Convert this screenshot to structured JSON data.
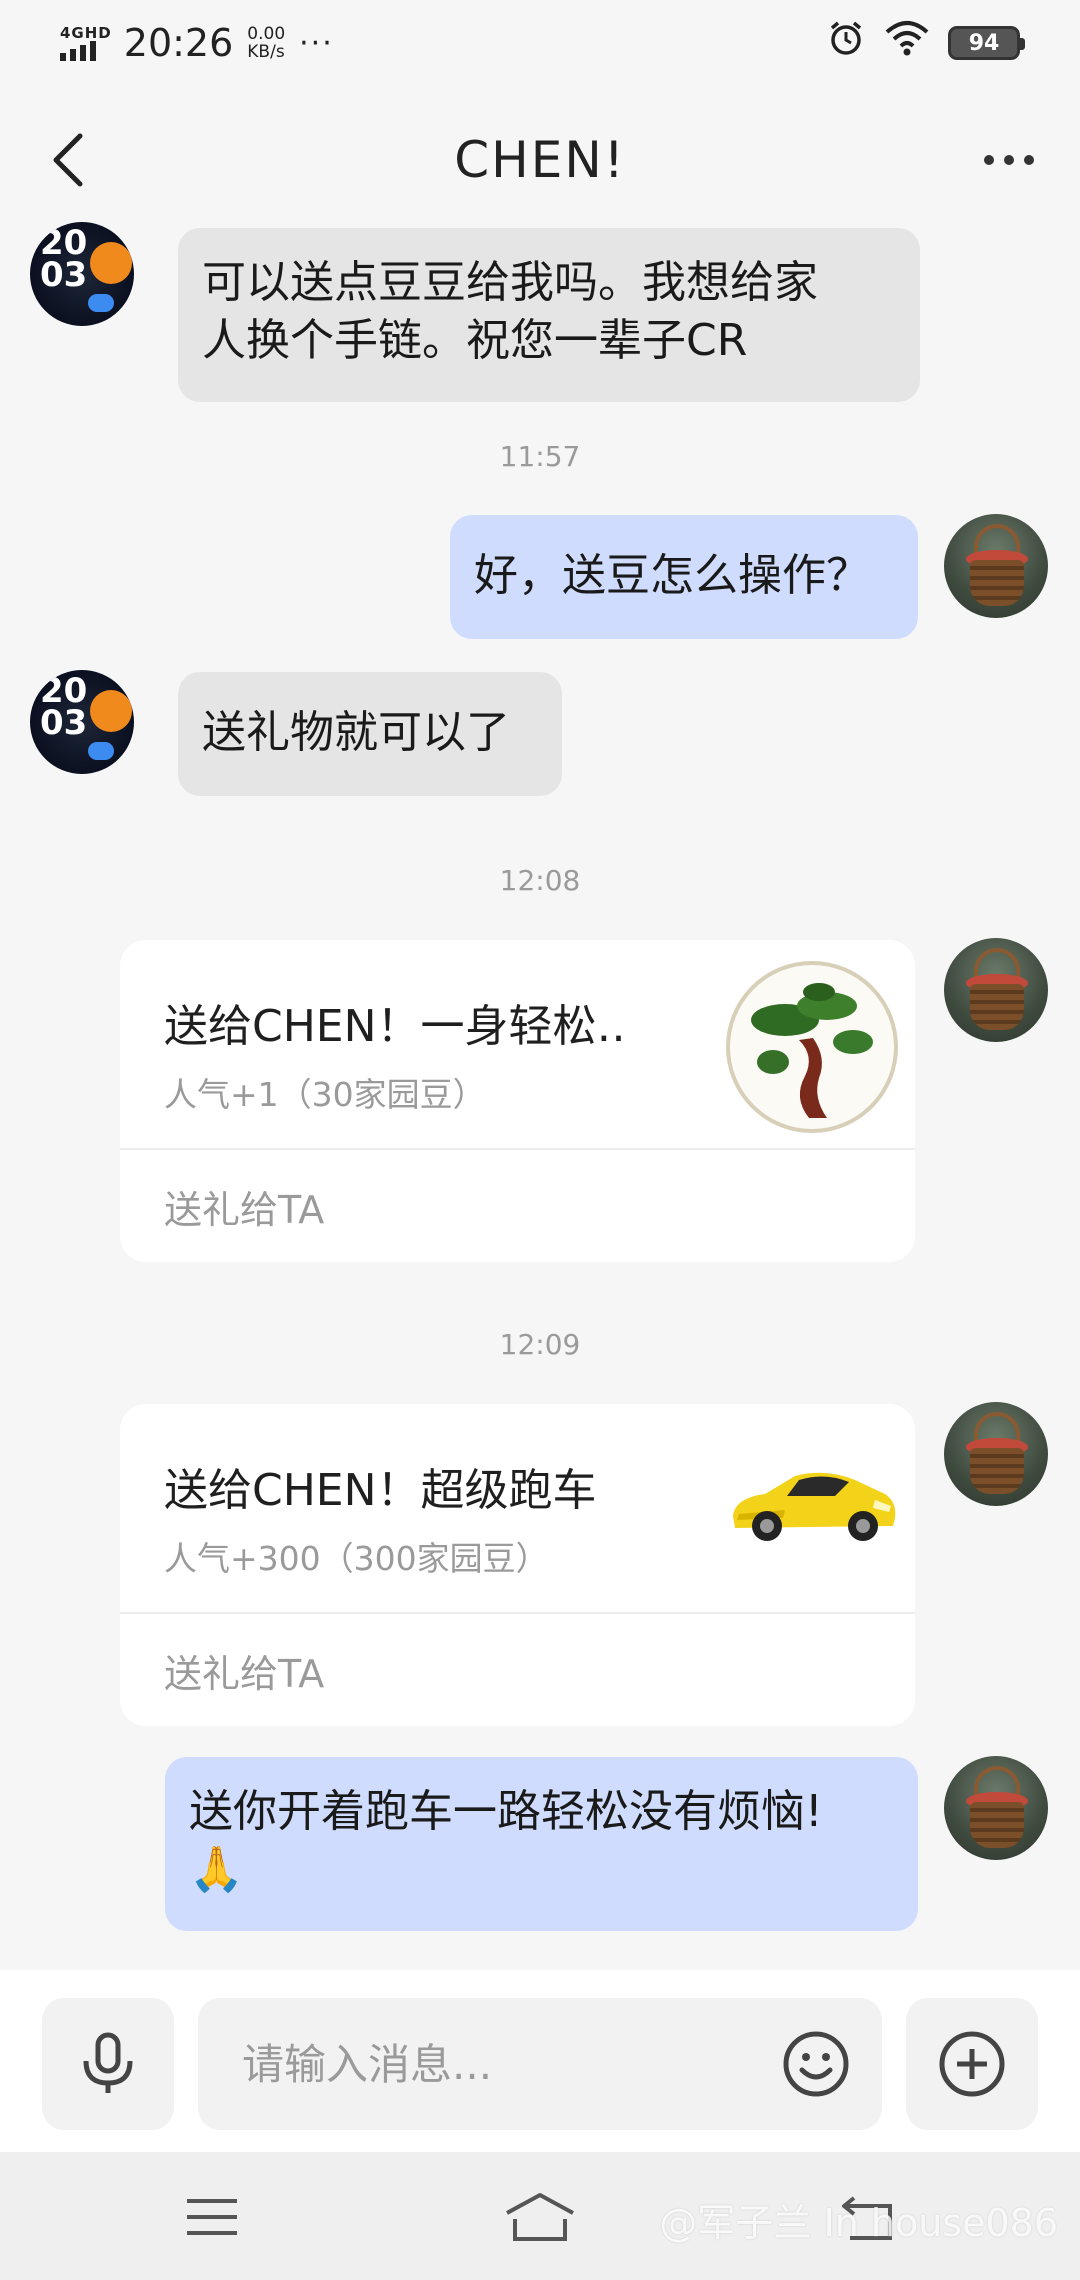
{
  "status_bar": {
    "network": "4GHD",
    "time": "20:26",
    "speed_value": "0.00",
    "speed_unit": "KB/s",
    "more": "···",
    "battery": "94"
  },
  "header": {
    "title": "CHEN!"
  },
  "messages": [
    {
      "text_line1": "可以送点豆豆给我吗。我想给家",
      "text_line2": "人换个手链。祝您一辈子CR"
    },
    {
      "timestamp": "11:57"
    },
    {
      "text": "好，送豆怎么操作？"
    },
    {
      "text": "送礼物就可以了"
    },
    {
      "timestamp": "12:08"
    },
    {
      "gift_title": "送给CHEN！一身轻松‥",
      "gift_sub": "人气+1（30家园豆）",
      "gift_action": "送礼给TA"
    },
    {
      "timestamp": "12:09"
    },
    {
      "gift_title": "送给CHEN！超级跑车",
      "gift_sub": "人气+300（300家园豆）",
      "gift_action": "送礼给TA"
    },
    {
      "text_line1": "送你开着跑车一路轻松没有烦恼!",
      "text_line2": "🙏"
    }
  ],
  "input": {
    "placeholder": "请输入消息..."
  },
  "watermark": "@军子兰 In house086",
  "colors": {
    "incoming_bubble": "#e5e5e5",
    "outgoing_bubble": "#cfdcfd",
    "background": "#f6f6f6"
  }
}
